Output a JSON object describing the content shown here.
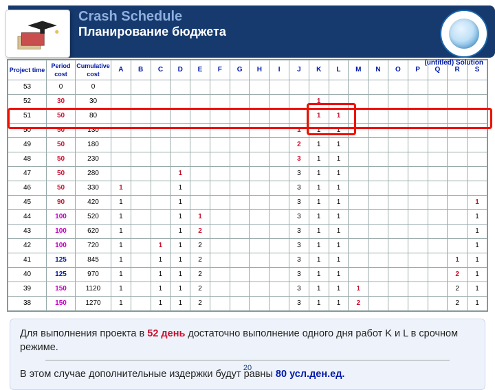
{
  "header": {
    "title1": "Crash Schedule",
    "title2": "Планирование бюджета",
    "caption": "(untitled) Solution"
  },
  "columns": [
    "Project time",
    "Period cost",
    "Cumulative cost",
    "A",
    "B",
    "C",
    "D",
    "E",
    "F",
    "G",
    "H",
    "I",
    "J",
    "K",
    "L",
    "M",
    "N",
    "O",
    "P",
    "Q",
    "R",
    "S"
  ],
  "rows": [
    {
      "pt": "53",
      "pc": "0",
      "pcClass": "",
      "cc": "0",
      "cells": {}
    },
    {
      "pt": "52",
      "pc": "30",
      "pcClass": "pc-red",
      "cc": "30",
      "cells": {
        "K": {
          "v": "1",
          "cls": "v-red"
        }
      }
    },
    {
      "pt": "51",
      "pc": "50",
      "pcClass": "pc-red",
      "cc": "80",
      "cells": {
        "K": {
          "v": "1",
          "cls": "v-red"
        },
        "L": {
          "v": "1",
          "cls": "v-red"
        }
      }
    },
    {
      "pt": "50",
      "pc": "50",
      "pcClass": "pc-red",
      "cc": "130",
      "cells": {
        "J": {
          "v": "1",
          "cls": "v-red"
        },
        "K": {
          "v": "1",
          "cls": ""
        },
        "L": {
          "v": "1",
          "cls": ""
        }
      }
    },
    {
      "pt": "49",
      "pc": "50",
      "pcClass": "pc-red",
      "cc": "180",
      "cells": {
        "J": {
          "v": "2",
          "cls": "v-red"
        },
        "K": {
          "v": "1",
          "cls": ""
        },
        "L": {
          "v": "1",
          "cls": ""
        }
      }
    },
    {
      "pt": "48",
      "pc": "50",
      "pcClass": "pc-red",
      "cc": "230",
      "cells": {
        "J": {
          "v": "3",
          "cls": "v-red"
        },
        "K": {
          "v": "1",
          "cls": ""
        },
        "L": {
          "v": "1",
          "cls": ""
        }
      }
    },
    {
      "pt": "47",
      "pc": "50",
      "pcClass": "pc-red",
      "cc": "280",
      "cells": {
        "D": {
          "v": "1",
          "cls": "v-red"
        },
        "J": {
          "v": "3",
          "cls": ""
        },
        "K": {
          "v": "1",
          "cls": ""
        },
        "L": {
          "v": "1",
          "cls": ""
        }
      }
    },
    {
      "pt": "46",
      "pc": "50",
      "pcClass": "pc-red",
      "cc": "330",
      "cells": {
        "A": {
          "v": "1",
          "cls": "v-red"
        },
        "D": {
          "v": "1",
          "cls": ""
        },
        "J": {
          "v": "3",
          "cls": ""
        },
        "K": {
          "v": "1",
          "cls": ""
        },
        "L": {
          "v": "1",
          "cls": ""
        }
      }
    },
    {
      "pt": "45",
      "pc": "90",
      "pcClass": "pc-red",
      "cc": "420",
      "cells": {
        "A": {
          "v": "1",
          "cls": ""
        },
        "D": {
          "v": "1",
          "cls": ""
        },
        "J": {
          "v": "3",
          "cls": ""
        },
        "K": {
          "v": "1",
          "cls": ""
        },
        "L": {
          "v": "1",
          "cls": ""
        },
        "S": {
          "v": "1",
          "cls": "v-red"
        }
      }
    },
    {
      "pt": "44",
      "pc": "100",
      "pcClass": "pc-mag",
      "cc": "520",
      "cells": {
        "A": {
          "v": "1",
          "cls": ""
        },
        "D": {
          "v": "1",
          "cls": ""
        },
        "E": {
          "v": "1",
          "cls": "v-red"
        },
        "J": {
          "v": "3",
          "cls": ""
        },
        "K": {
          "v": "1",
          "cls": ""
        },
        "L": {
          "v": "1",
          "cls": ""
        },
        "S": {
          "v": "1",
          "cls": ""
        }
      }
    },
    {
      "pt": "43",
      "pc": "100",
      "pcClass": "pc-mag",
      "cc": "620",
      "cells": {
        "A": {
          "v": "1",
          "cls": ""
        },
        "D": {
          "v": "1",
          "cls": ""
        },
        "E": {
          "v": "2",
          "cls": "v-red"
        },
        "J": {
          "v": "3",
          "cls": ""
        },
        "K": {
          "v": "1",
          "cls": ""
        },
        "L": {
          "v": "1",
          "cls": ""
        },
        "S": {
          "v": "1",
          "cls": ""
        }
      }
    },
    {
      "pt": "42",
      "pc": "100",
      "pcClass": "pc-mag",
      "cc": "720",
      "cells": {
        "A": {
          "v": "1",
          "cls": ""
        },
        "C": {
          "v": "1",
          "cls": "v-red"
        },
        "D": {
          "v": "1",
          "cls": ""
        },
        "E": {
          "v": "2",
          "cls": ""
        },
        "J": {
          "v": "3",
          "cls": ""
        },
        "K": {
          "v": "1",
          "cls": ""
        },
        "L": {
          "v": "1",
          "cls": ""
        },
        "S": {
          "v": "1",
          "cls": ""
        }
      }
    },
    {
      "pt": "41",
      "pc": "125",
      "pcClass": "pc-blue",
      "cc": "845",
      "cells": {
        "A": {
          "v": "1",
          "cls": ""
        },
        "C": {
          "v": "1",
          "cls": ""
        },
        "D": {
          "v": "1",
          "cls": ""
        },
        "E": {
          "v": "2",
          "cls": ""
        },
        "J": {
          "v": "3",
          "cls": ""
        },
        "K": {
          "v": "1",
          "cls": ""
        },
        "L": {
          "v": "1",
          "cls": ""
        },
        "R": {
          "v": "1",
          "cls": "v-red"
        },
        "S": {
          "v": "1",
          "cls": ""
        }
      }
    },
    {
      "pt": "40",
      "pc": "125",
      "pcClass": "pc-blue",
      "cc": "970",
      "cells": {
        "A": {
          "v": "1",
          "cls": ""
        },
        "C": {
          "v": "1",
          "cls": ""
        },
        "D": {
          "v": "1",
          "cls": ""
        },
        "E": {
          "v": "2",
          "cls": ""
        },
        "J": {
          "v": "3",
          "cls": ""
        },
        "K": {
          "v": "1",
          "cls": ""
        },
        "L": {
          "v": "1",
          "cls": ""
        },
        "R": {
          "v": "2",
          "cls": "v-red"
        },
        "S": {
          "v": "1",
          "cls": ""
        }
      }
    },
    {
      "pt": "39",
      "pc": "150",
      "pcClass": "pc-mag",
      "cc": "1120",
      "cells": {
        "A": {
          "v": "1",
          "cls": ""
        },
        "C": {
          "v": "1",
          "cls": ""
        },
        "D": {
          "v": "1",
          "cls": ""
        },
        "E": {
          "v": "2",
          "cls": ""
        },
        "J": {
          "v": "3",
          "cls": ""
        },
        "K": {
          "v": "1",
          "cls": ""
        },
        "L": {
          "v": "1",
          "cls": ""
        },
        "M": {
          "v": "1",
          "cls": "v-red"
        },
        "R": {
          "v": "2",
          "cls": ""
        },
        "S": {
          "v": "1",
          "cls": ""
        }
      }
    },
    {
      "pt": "38",
      "pc": "150",
      "pcClass": "pc-mag",
      "cc": "1270",
      "cells": {
        "A": {
          "v": "1",
          "cls": ""
        },
        "C": {
          "v": "1",
          "cls": ""
        },
        "D": {
          "v": "1",
          "cls": ""
        },
        "E": {
          "v": "2",
          "cls": ""
        },
        "J": {
          "v": "3",
          "cls": ""
        },
        "K": {
          "v": "1",
          "cls": ""
        },
        "L": {
          "v": "1",
          "cls": ""
        },
        "M": {
          "v": "2",
          "cls": "v-red"
        },
        "R": {
          "v": "2",
          "cls": ""
        },
        "S": {
          "v": "1",
          "cls": ""
        }
      }
    }
  ],
  "explain": {
    "pre1": "Для выполнения проекта в ",
    "days": "52 день",
    "post1": "  достаточно выполнение одного дня работ K и L в срочном режиме.",
    "line2a": "В этом случае дополнительные издержки будут равны  ",
    "cost": "80 усл.ден.ед."
  },
  "page": "20",
  "activityCols": [
    "A",
    "B",
    "C",
    "D",
    "E",
    "F",
    "G",
    "H",
    "I",
    "J",
    "K",
    "L",
    "M",
    "N",
    "O",
    "P",
    "Q",
    "R",
    "S"
  ]
}
